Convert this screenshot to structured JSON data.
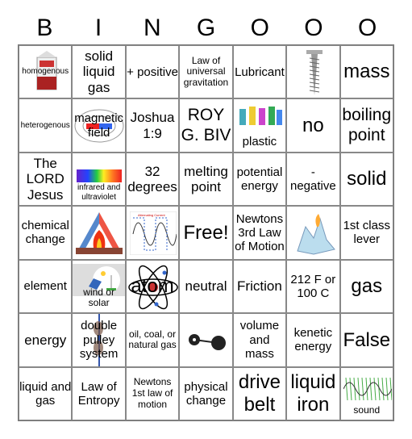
{
  "header": [
    "B",
    "I",
    "N",
    "G",
    "O",
    "O",
    "O"
  ],
  "cells": [
    {
      "text": "homogenous",
      "size": "s9",
      "pic": "milk-carton"
    },
    {
      "text": "solid liquid gas",
      "size": "s16"
    },
    {
      "text": "+ positive",
      "size": "s14"
    },
    {
      "text": "Law of universal gravitation",
      "size": "s11"
    },
    {
      "text": "Lubricant",
      "size": "s14"
    },
    {
      "text": "",
      "pic": "screw"
    },
    {
      "text": "mass",
      "size": "s24"
    },
    {
      "text": "heterogenous",
      "size": "s9"
    },
    {
      "text": "magnetic field",
      "size": "s14",
      "pic": "magnet"
    },
    {
      "text": "Joshua 1:9",
      "size": "s16"
    },
    {
      "text": "ROY G. BIV",
      "size": "s20"
    },
    {
      "text": "plastic",
      "size": "s14",
      "pic": "plastic-bottles"
    },
    {
      "text": "no",
      "size": "s24"
    },
    {
      "text": "boiling point",
      "size": "s20"
    },
    {
      "text": "The LORD Jesus",
      "size": "s16"
    },
    {
      "text": "infrared and ultraviolet",
      "size": "s9",
      "pic": "spectrum"
    },
    {
      "text": "32 degrees",
      "size": "s16"
    },
    {
      "text": "melting point",
      "size": "s16"
    },
    {
      "text": "potential energy",
      "size": "s14"
    },
    {
      "text": "- negative",
      "size": "s14"
    },
    {
      "text": "solid",
      "size": "s24"
    },
    {
      "text": "chemical change",
      "size": "s14"
    },
    {
      "text": "",
      "pic": "fire-triangle"
    },
    {
      "text": "",
      "pic": "ac-graph"
    },
    {
      "text": "Free!",
      "size": "s24"
    },
    {
      "text": "Newtons 3rd Law of Motion",
      "size": "s14"
    },
    {
      "text": "",
      "pic": "ice-crystal"
    },
    {
      "text": "1st class lever",
      "size": "s14"
    },
    {
      "text": "element",
      "size": "s14"
    },
    {
      "text": "wind or solar",
      "size": "s11",
      "pic": "wind-solar"
    },
    {
      "text": "atom",
      "size": "s24",
      "pic": "atom"
    },
    {
      "text": "neutral",
      "size": "s16"
    },
    {
      "text": "Friction",
      "size": "s16"
    },
    {
      "text": "212 F or 100 C",
      "size": "s14"
    },
    {
      "text": "gas",
      "size": "s24"
    },
    {
      "text": "energy",
      "size": "s16"
    },
    {
      "text": "double pulley system",
      "size": "s14",
      "pic": "pulley"
    },
    {
      "text": "oil, coal, or natural gas",
      "size": "s11"
    },
    {
      "text": "",
      "pic": "weights"
    },
    {
      "text": "volume and mass",
      "size": "s14"
    },
    {
      "text": "kenetic energy",
      "size": "s14"
    },
    {
      "text": "False",
      "size": "s24"
    },
    {
      "text": "liquid and gas",
      "size": "s14"
    },
    {
      "text": "Law of Entropy",
      "size": "s14"
    },
    {
      "text": "Newtons 1st law of motion",
      "size": "s11"
    },
    {
      "text": "physical change",
      "size": "s14"
    },
    {
      "text": "drive belt",
      "size": "s24"
    },
    {
      "text": "liquid iron",
      "size": "s24"
    },
    {
      "text": "sound",
      "size": "s11",
      "pic": "sound-wave"
    }
  ]
}
